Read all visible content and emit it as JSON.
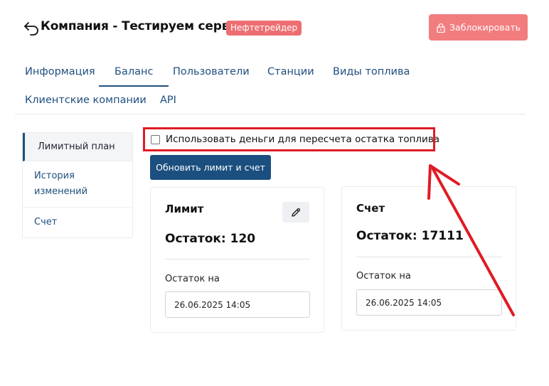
{
  "header": {
    "title": "Компания - Тестируем сервис",
    "badge": "Нефтетрейдер",
    "block_button_label": "Заблокировать"
  },
  "tabs": [
    {
      "label": "Информация",
      "active": false
    },
    {
      "label": "Баланс",
      "active": true
    },
    {
      "label": "Пользователи",
      "active": false
    },
    {
      "label": "Станции",
      "active": false
    },
    {
      "label": "Виды топлива",
      "active": false
    },
    {
      "label": "Клиентские компании",
      "active": false
    },
    {
      "label": "API",
      "active": false
    }
  ],
  "side_menu": [
    {
      "label": "Лимитный план",
      "active": true
    },
    {
      "label": "История изменений",
      "active": false
    },
    {
      "label": "Счет",
      "active": false
    }
  ],
  "balance": {
    "use_money_checkbox_label": "Использовать деньги для пересчета остатка топлива",
    "use_money_checked": false,
    "update_button_label": "Обновить лимит и счет",
    "limit_card": {
      "title": "Лимит",
      "balance_text": "Остаток: 120",
      "date_label": "Остаток на",
      "date_value": "26.06.2025 14:05"
    },
    "account_card": {
      "title": "Счет",
      "balance_text": "Остаток: 17111",
      "date_label": "Остаток на",
      "date_value": "26.06.2025 14:05"
    }
  },
  "icons": {
    "back": "back-arrow-icon",
    "lock": "lock-icon",
    "edit": "pencil-icon"
  },
  "colors": {
    "primary": "#1b4f7f",
    "danger": "#f27d7f",
    "badge": "#ec6e70",
    "annotation": "#e01b24"
  }
}
